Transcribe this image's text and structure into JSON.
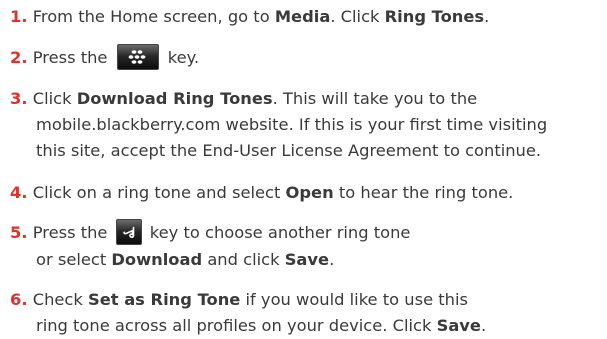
{
  "steps": [
    {
      "num": "1.",
      "t1": "From the Home screen, go to ",
      "b1": "Media",
      "t2": ". Click ",
      "b2": "Ring Tones",
      "t3": "."
    },
    {
      "num": "2.",
      "t1": "Press the ",
      "icon": "blackberry-menu-key-icon",
      "t2": " key."
    },
    {
      "num": "3.",
      "t1": "Click ",
      "b1": "Download Ring Tones",
      "t2": ". This will take you to the",
      "l2": "mobile.blackberry.com website. If this is your first time visiting",
      "l3": "this site, accept the End-User License Agreement to continue."
    },
    {
      "num": "4.",
      "t1": "Click on a ring tone and select ",
      "b1": "Open",
      "t2": " to hear the ring tone."
    },
    {
      "num": "5.",
      "t1": "Press the ",
      "icon": "escape-key-icon",
      "t2": " key to choose another ring tone",
      "l2a": "or select ",
      "b2": "Download",
      "l2b": " and click ",
      "b3": "Save",
      "l2c": "."
    },
    {
      "num": "6.",
      "t1": "Check ",
      "b1": "Set as Ring Tone",
      "t2": " if you would like to use this",
      "l2a": "ring tone across all profiles on your device. Click ",
      "b2": "Save",
      "l2b": "."
    }
  ],
  "colors": {
    "step_number": "#e0312b",
    "text": "#3a3a3a"
  }
}
